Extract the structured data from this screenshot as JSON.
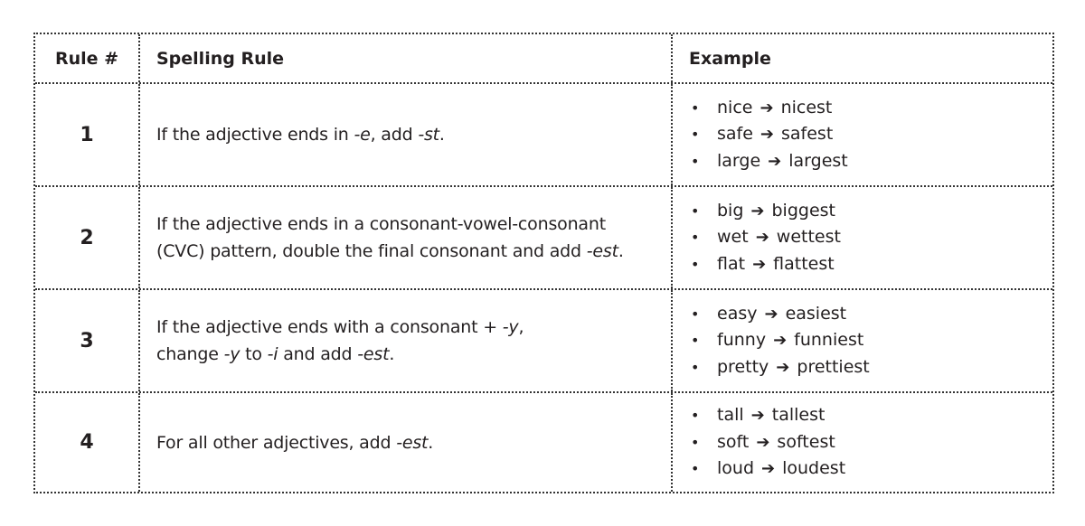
{
  "table": {
    "headers": [
      "Rule #",
      "Spelling Rule",
      "Example"
    ],
    "rows": [
      {
        "number": "1",
        "rule_parts": [
          {
            "text": "If the adjective ends in ",
            "italic": false
          },
          {
            "text": "-e",
            "italic": true
          },
          {
            "text": ", add ",
            "italic": false
          },
          {
            "text": "-st",
            "italic": true
          },
          {
            "text": ".",
            "italic": false
          }
        ],
        "examples": [
          {
            "base": "nice",
            "superlative": "nicest"
          },
          {
            "base": "safe",
            "superlative": "safest"
          },
          {
            "base": "large",
            "superlative": "largest"
          }
        ]
      },
      {
        "number": "2",
        "rule_parts": [
          {
            "text": "If the adjective ends in a consonant-vowel-consonant",
            "italic": false,
            "br": true
          },
          {
            "text": "(CVC) pattern, double the final consonant and add ",
            "italic": false
          },
          {
            "text": "-est",
            "italic": true
          },
          {
            "text": ".",
            "italic": false
          }
        ],
        "examples": [
          {
            "base": "big",
            "superlative": "biggest"
          },
          {
            "base": "wet",
            "superlative": "wettest"
          },
          {
            "base": "flat",
            "superlative": "flattest"
          }
        ]
      },
      {
        "number": "3",
        "rule_parts": [
          {
            "text": "If the adjective ends with a consonant + ",
            "italic": false
          },
          {
            "text": "-y",
            "italic": true
          },
          {
            "text": ",",
            "italic": false,
            "br": true
          },
          {
            "text": "change ",
            "italic": false
          },
          {
            "text": "-y",
            "italic": true
          },
          {
            "text": " to ",
            "italic": false
          },
          {
            "text": "-i",
            "italic": true
          },
          {
            "text": " and add ",
            "italic": false
          },
          {
            "text": "-est",
            "italic": true
          },
          {
            "text": ".",
            "italic": false
          }
        ],
        "examples": [
          {
            "base": "easy",
            "superlative": "easiest"
          },
          {
            "base": "funny",
            "superlative": "funniest"
          },
          {
            "base": "pretty",
            "superlative": "prettiest"
          }
        ]
      },
      {
        "number": "4",
        "rule_parts": [
          {
            "text": "For all other adjectives, add ",
            "italic": false
          },
          {
            "text": "-est",
            "italic": true
          },
          {
            "text": ".",
            "italic": false
          }
        ],
        "examples": [
          {
            "base": "tall",
            "superlative": "tallest"
          },
          {
            "base": "soft",
            "superlative": "softest"
          },
          {
            "base": "loud",
            "superlative": "loudest"
          }
        ]
      }
    ],
    "bullet_glyph": "•",
    "arrow_icon": "right-arrow-icon",
    "arrow_glyph": "➔"
  }
}
